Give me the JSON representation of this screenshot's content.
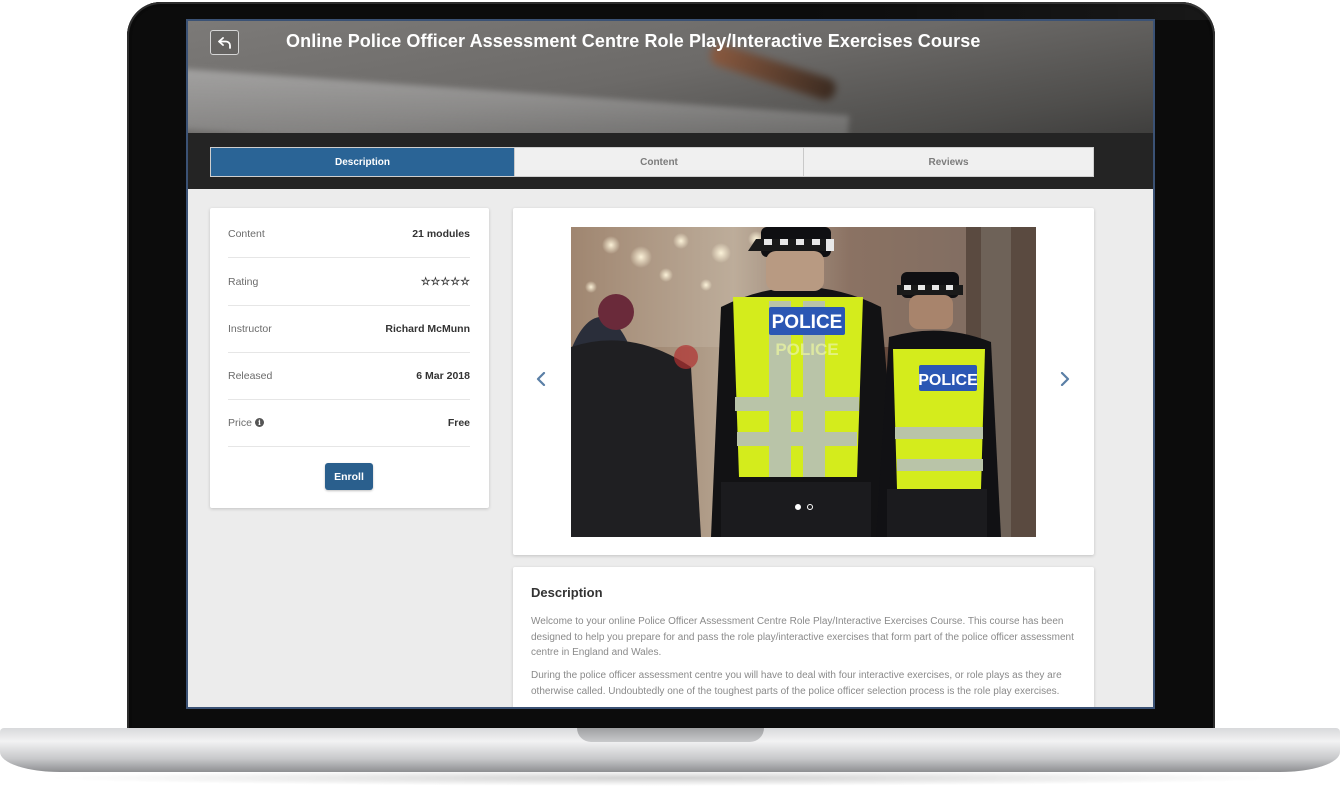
{
  "header": {
    "title": "Online Police Officer Assessment Centre Role Play/Interactive Exercises Course",
    "back_icon": "back-arrow-icon"
  },
  "tabs": [
    {
      "label": "Description",
      "active": true
    },
    {
      "label": "Content",
      "active": false
    },
    {
      "label": "Reviews",
      "active": false
    }
  ],
  "info": {
    "rows": [
      {
        "label": "Content",
        "value": "21 modules"
      },
      {
        "label": "Rating",
        "value": "☆☆☆☆☆",
        "stars": 0
      },
      {
        "label": "Instructor",
        "value": "Richard McMunn"
      },
      {
        "label": "Released",
        "value": "6 Mar 2018"
      },
      {
        "label": "Price",
        "value": "Free",
        "icon": "info-icon"
      }
    ],
    "enroll_label": "Enroll"
  },
  "carousel": {
    "slide_count": 2,
    "active_index": 0,
    "badge_text": "POLICE",
    "badge_text_faded": "POLICE"
  },
  "description": {
    "title": "Description",
    "paragraphs": [
      "Welcome to your online Police Officer Assessment Centre Role Play/Interactive Exercises Course. This course has been designed to help you prepare for and pass the role play/interactive exercises that form part of the police officer assessment centre in England and Wales.",
      "During the police officer assessment centre you will have to deal with four interactive exercises, or role plays as they are otherwise called. Undoubtedly one of the toughest parts of the police officer selection process is the role play exercises."
    ]
  },
  "colors": {
    "accent": "#2a6496",
    "enroll": "#2a5f8d",
    "star": "#e09a3a",
    "frame": "#3b5275"
  }
}
